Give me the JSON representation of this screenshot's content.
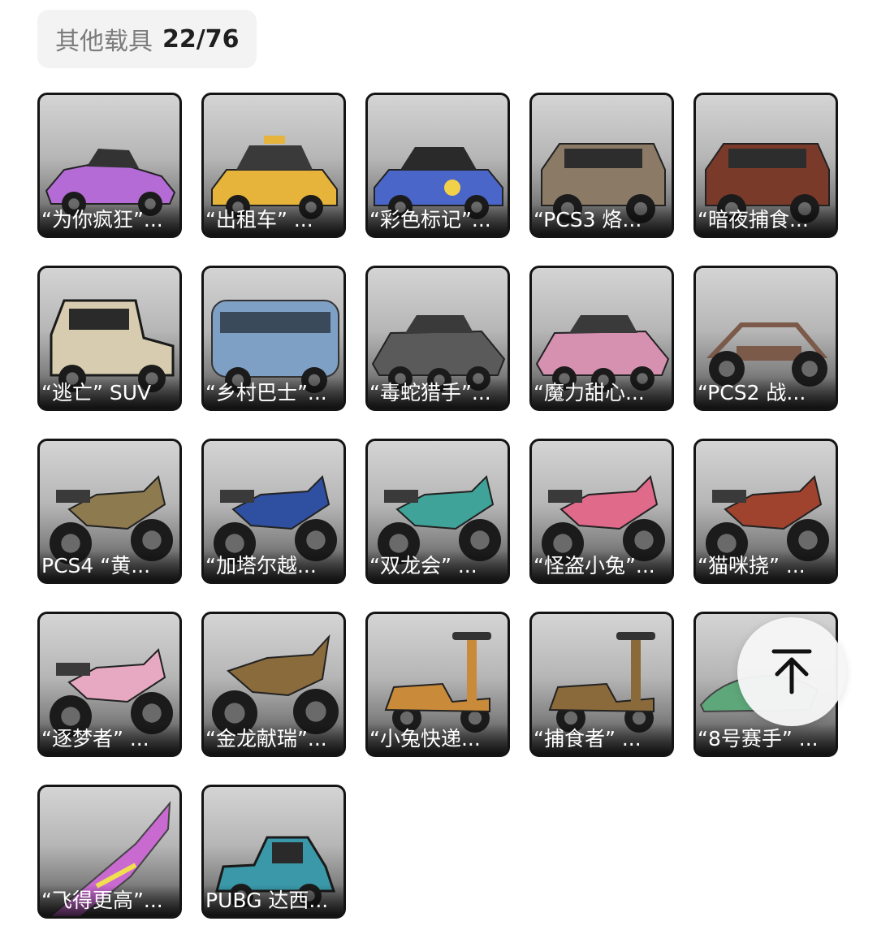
{
  "header": {
    "category": "其他载具",
    "count": "22/76"
  },
  "items": [
    {
      "label": "“为你疯狂”...",
      "icon": "sports-car-icon",
      "color": "#b46bd6"
    },
    {
      "label": "“出租车” ...",
      "icon": "taxi-icon",
      "color": "#e6b43a"
    },
    {
      "label": "“彩色标记”...",
      "icon": "sedan-icon",
      "color": "#4a66c9"
    },
    {
      "label": "“PCS3 烙...",
      "icon": "suv-icon",
      "color": "#8a7a66"
    },
    {
      "label": "“暗夜捕食...",
      "icon": "suv-icon",
      "color": "#7a3a2a"
    },
    {
      "label": "“逃亡” SUV",
      "icon": "classic-car-icon",
      "color": "#d8ccb0"
    },
    {
      "label": "“乡村巴士”...",
      "icon": "bus-icon",
      "color": "#7ea0c4"
    },
    {
      "label": "“毒蛇猎手”...",
      "icon": "armored-vehicle-icon",
      "color": "#5a5a5a"
    },
    {
      "label": "“魔力甜心...",
      "icon": "armored-vehicle-icon",
      "color": "#d690b0"
    },
    {
      "label": "“PCS2 战...",
      "icon": "buggy-icon",
      "color": "#7b5a4a"
    },
    {
      "label": "PCS4 “黄...",
      "icon": "motorcycle-icon",
      "color": "#8d7a4e"
    },
    {
      "label": "“加塔尔越...",
      "icon": "motorcycle-icon",
      "color": "#2f4fa0"
    },
    {
      "label": "“双龙会” ...",
      "icon": "motorcycle-icon",
      "color": "#3fa39a"
    },
    {
      "label": "“怪盗小兔”...",
      "icon": "motorcycle-icon",
      "color": "#e06a8a"
    },
    {
      "label": "“猫咪挠” ...",
      "icon": "motorcycle-icon",
      "color": "#a0432e"
    },
    {
      "label": "“逐梦者” ...",
      "icon": "motorcycle-icon",
      "color": "#e7a9c2"
    },
    {
      "label": "“金龙献瑞”...",
      "icon": "dirt-bike-icon",
      "color": "#8a6b3c"
    },
    {
      "label": "“小兔快递...",
      "icon": "scooter-icon",
      "color": "#c98a3a"
    },
    {
      "label": "“捕食者” ...",
      "icon": "scooter-icon",
      "color": "#8a6a3a"
    },
    {
      "label": "“8号赛手” ...",
      "icon": "jet-ski-icon",
      "color": "#5ea77a"
    },
    {
      "label": "“飞得更高”...",
      "icon": "glider-icon",
      "color": "#c86ad0"
    },
    {
      "label": "PUBG 达西...",
      "icon": "pickup-truck-icon",
      "color": "#3a98a8"
    }
  ],
  "scroll_top": {
    "icon": "arrow-up-to-top-icon"
  }
}
